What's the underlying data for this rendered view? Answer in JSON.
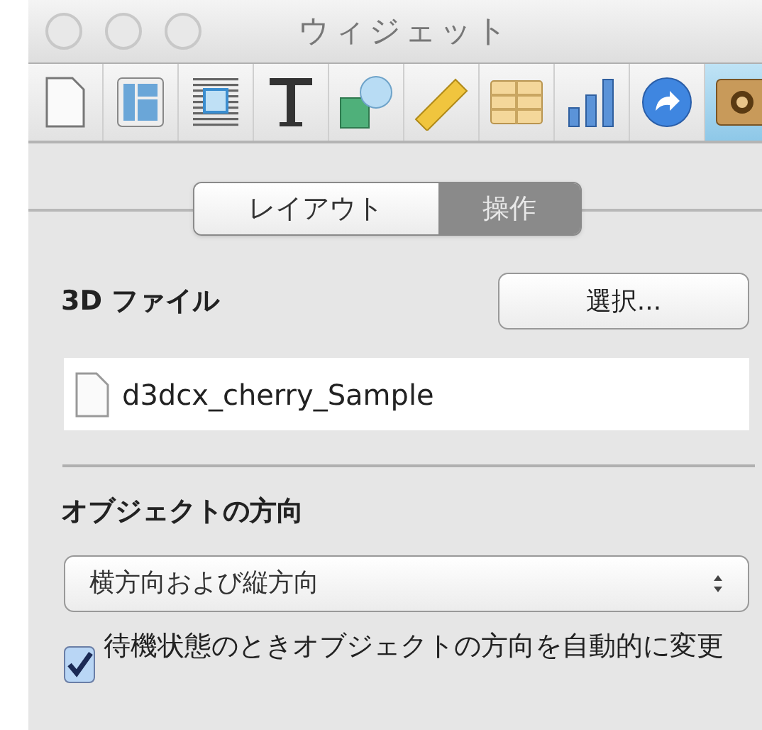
{
  "window": {
    "title": "ウィジェット"
  },
  "toolbar": [
    {
      "selected": false
    },
    {
      "selected": false
    },
    {
      "selected": false
    },
    {
      "selected": false
    },
    {
      "selected": false
    },
    {
      "selected": false
    },
    {
      "selected": false
    },
    {
      "selected": false
    },
    {
      "selected": false
    },
    {
      "selected": true
    }
  ],
  "tabs": [
    {
      "label": "レイアウト",
      "selected": false
    },
    {
      "label": "操作",
      "selected": true
    }
  ],
  "file_section": {
    "label": "3D ファイル",
    "button": "選択...",
    "file_name": "d3dcx_cherry_Sample"
  },
  "orientation_section": {
    "label": "オブジェクトの方向",
    "popup": {
      "value": "横方向および縦方向"
    },
    "checkbox": {
      "label": "待機状態のときオブジェクトの方向を自動的に変更",
      "checked": true
    }
  }
}
